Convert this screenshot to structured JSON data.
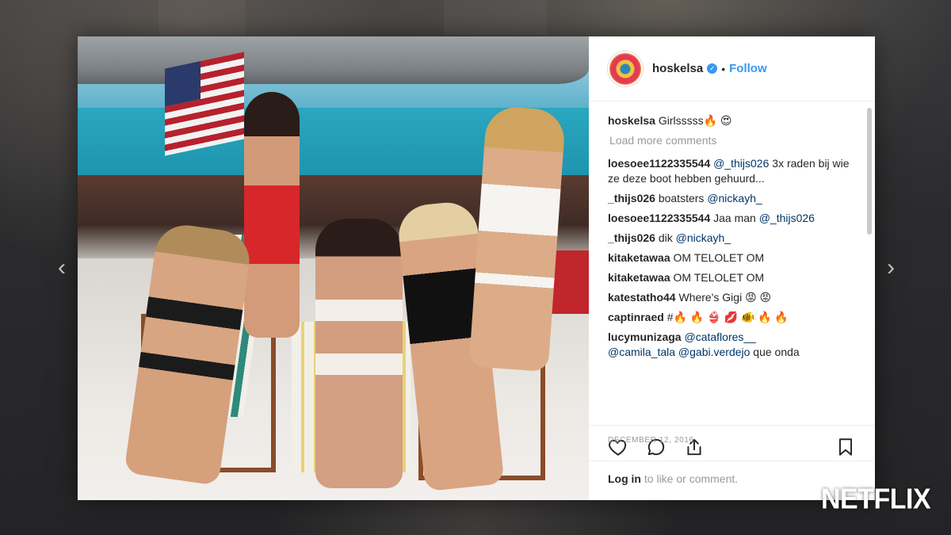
{
  "post": {
    "username": "hoskelsa",
    "follow_label": "Follow",
    "separator": "•"
  },
  "comments": {
    "caption": {
      "user": "hoskelsa",
      "text": " Girlsssss🔥 😍"
    },
    "load_more": "Load more comments",
    "items": [
      {
        "user": "loesoee1122335544",
        "mention": "@_thijs026",
        "text": " 3x raden bij wie ze deze boot hebben gehuurd..."
      },
      {
        "user": "_thijs026",
        "text": " boatsters ",
        "mention": "@nickayh_"
      },
      {
        "user": "loesoee1122335544",
        "text": " Jaa man ",
        "mention": "@_thijs026"
      },
      {
        "user": "_thijs026",
        "text": " dik ",
        "mention": "@nickayh_"
      },
      {
        "user": "kitaketawaa",
        "text": " OM TELOLET OM"
      },
      {
        "user": "kitaketawaa",
        "text": " OM TELOLET OM"
      },
      {
        "user": "katestatho44",
        "text": " Where's Gigi 😡 😡"
      },
      {
        "user": "captinraed",
        "text": " #🔥 🔥 👙 💋 🐠 🔥 🔥"
      },
      {
        "user": "lucymunizaga",
        "mention": "@cataflores__",
        "mention2": "@camila_tala",
        "mention3": "@gabi.verdejo",
        "text": " que onda"
      }
    ]
  },
  "date": "December 12, 2016",
  "login": {
    "link": "Log in",
    "rest": " to like or comment."
  },
  "watermark": "NETFLIX",
  "icons": {
    "verified": "verified-badge-icon",
    "like": "heart-icon",
    "comment": "comment-bubble-icon",
    "share": "share-icon",
    "save": "bookmark-icon",
    "prev": "chevron-left-icon",
    "next": "chevron-right-icon"
  },
  "colors": {
    "accent": "#3897f0",
    "mention": "#003569",
    "text": "#262626",
    "muted": "#999999"
  }
}
